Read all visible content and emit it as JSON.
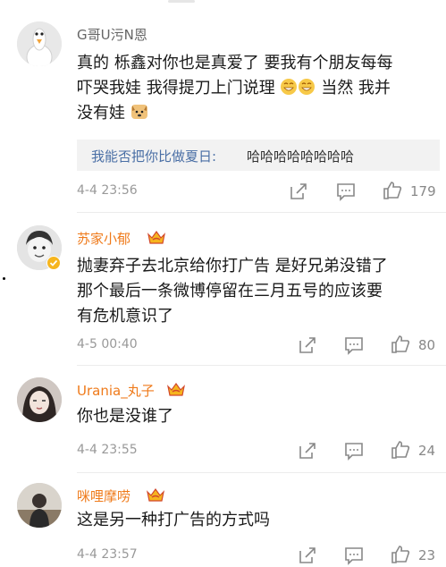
{
  "comments": [
    {
      "username": "G哥U污N恩",
      "text_lines": [
        "真的 栎鑫对你也是真爱了 要我有个朋友每每",
        "吓哭我娃 我得提刀上门说理",
        "没有娃"
      ],
      "emoji_line2_suffix": "当然 我并",
      "reply": {
        "name": "我能否把你比做夏日:",
        "text": "哈哈哈哈哈哈哈哈"
      },
      "time": "4-4 23:56",
      "likes": "179"
    },
    {
      "username": "苏家小郁",
      "text_lines": [
        "抛妻弃子去北京给你打广告 是好兄弟没错了",
        "那个最后一条微博停留在三月五号的应该要",
        "有危机意识了"
      ],
      "time": "4-5 00:40",
      "likes": "80"
    },
    {
      "username": "Urania_丸子",
      "text_lines": [
        "你也是没谁了"
      ],
      "time": "4-4 23:55",
      "likes": "24"
    },
    {
      "username": "咪哩摩唠",
      "text_lines": [
        "这是另一种打广告的方式吗"
      ],
      "time": "4-4 23:57",
      "likes": "23"
    }
  ],
  "colors": {
    "vip_name": "#ef7a1a",
    "reply_name": "#4a6fa5",
    "divider": "#ececec"
  },
  "icons": [
    "goose-avatar",
    "crown-badge-icon",
    "verified-badge-icon",
    "share-icon",
    "comment-icon",
    "like-icon",
    "grin-emoji-icon",
    "dog-emoji-icon"
  ]
}
